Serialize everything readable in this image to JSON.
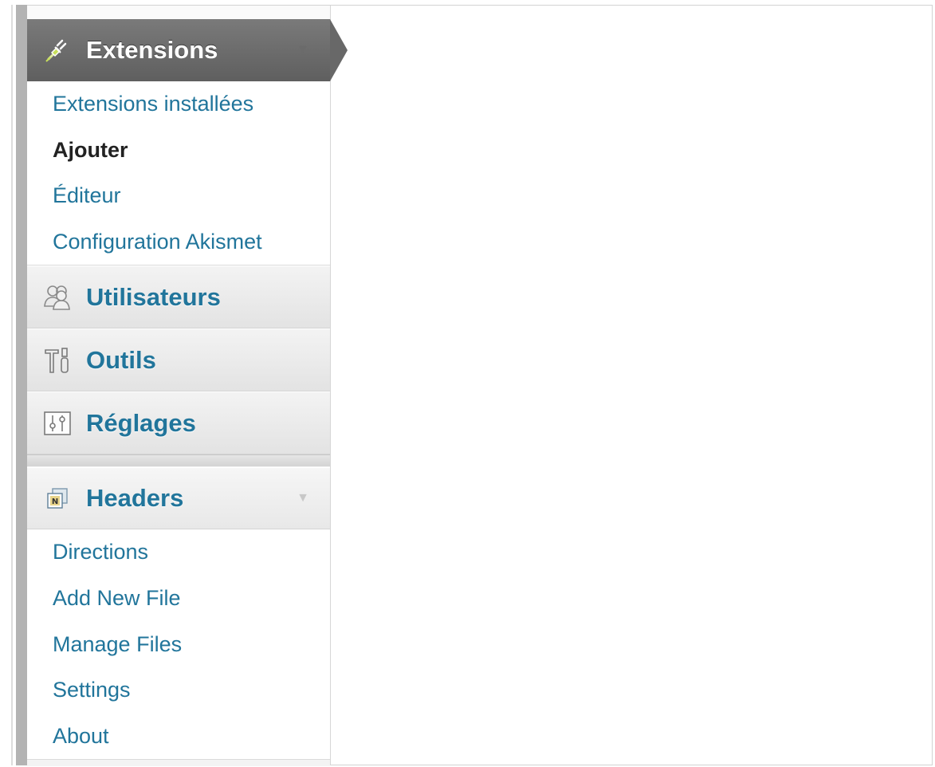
{
  "menu": {
    "extensions": {
      "title": "Extensions",
      "icon": "plugin-icon",
      "items": [
        {
          "label": "Extensions installées",
          "current": false
        },
        {
          "label": "Ajouter",
          "current": true
        },
        {
          "label": "Éditeur",
          "current": false
        },
        {
          "label": "Configuration Akismet",
          "current": false
        }
      ]
    },
    "users": {
      "title": "Utilisateurs",
      "icon": "users-icon"
    },
    "tools": {
      "title": "Outils",
      "icon": "tools-icon"
    },
    "settings": {
      "title": "Réglages",
      "icon": "settings-icon"
    },
    "headers": {
      "title": "Headers",
      "icon": "headers-plugin-icon",
      "items": [
        {
          "label": "Directions"
        },
        {
          "label": "Add New File"
        },
        {
          "label": "Manage Files"
        },
        {
          "label": "Settings"
        },
        {
          "label": "About"
        }
      ]
    }
  },
  "colors": {
    "link": "#21759b",
    "active_bg": "#6d6d6d",
    "current_text": "#222222"
  }
}
